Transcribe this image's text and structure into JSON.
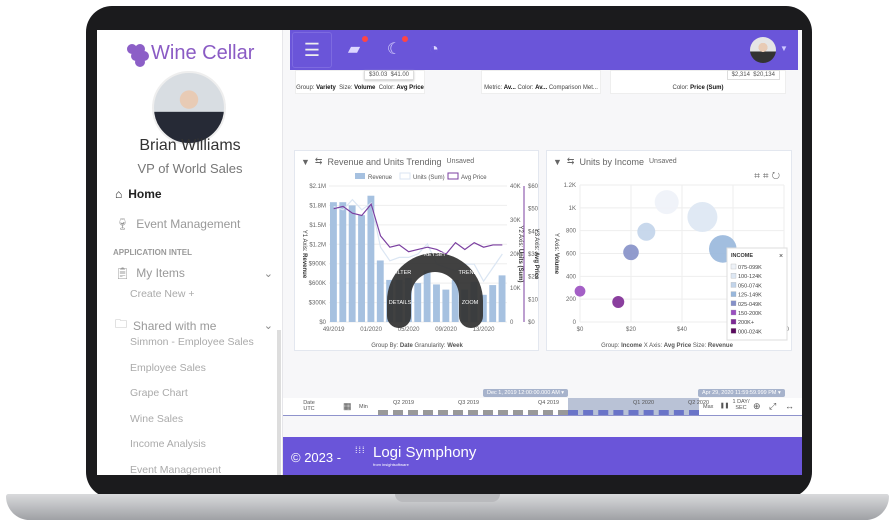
{
  "app": {
    "title": "Wine Cellar"
  },
  "user": {
    "name": "Brian Williams",
    "role": "VP of World Sales"
  },
  "sidebar": {
    "home": "Home",
    "event": "Event Management",
    "section": "APPLICATION INTEL",
    "my_items": "My Items",
    "create_new": "Create New",
    "shared": "Shared with me",
    "shared_items": [
      "Simmon - Employee Sales",
      "Employee Sales",
      "Grape Chart",
      "Wine Sales",
      "Income Analysis",
      "Event Management"
    ]
  },
  "header": {
    "icons": [
      "menu-icon",
      "chat-icon",
      "moon-icon",
      "dashboard-eye-icon"
    ],
    "accent": "#6a55d9"
  },
  "top_cards": [
    {
      "footer": [
        [
          "Group:",
          "Variety"
        ],
        [
          "Size:",
          "Volume"
        ],
        [
          "Color:",
          "Avg Price"
        ]
      ],
      "values": [
        "$30.03",
        "$41.00"
      ]
    },
    {
      "footer": [
        [
          "Metric:",
          "Av..."
        ],
        [
          "Color:",
          "Av..."
        ],
        [
          "Comparison Met...",
          ""
        ]
      ]
    },
    {
      "footer": [
        [
          "Color:",
          "Price (Sum)"
        ]
      ],
      "values": [
        "$2,314",
        "$20,134"
      ]
    }
  ],
  "trend": {
    "title": "Revenue and Units Trending",
    "status": "Unsaved",
    "footer": [
      [
        "Group By:",
        "Date"
      ],
      [
        "Granularity:",
        "Week"
      ]
    ],
    "radial_menu": [
      "KEYSET",
      "FILTER",
      "TREND",
      "DETAILS",
      "ZOOM"
    ],
    "chart_data": {
      "type": "bar",
      "x_ticks": [
        "49/2019",
        "01/2020",
        "05/2020",
        "09/2020",
        "13/2020"
      ],
      "series": [
        {
          "name": "Revenue",
          "axis": "Y1 Axis: Revenue",
          "color": "#a6c1e0",
          "values": [
            1850000,
            1850000,
            1800000,
            1650000,
            1950000,
            950000,
            650000,
            650000,
            680000,
            600000,
            800000,
            580000,
            500000,
            650000,
            500000,
            620000,
            420000,
            570000,
            720000
          ]
        },
        {
          "name": "Units (Sum)",
          "axis": "Y2 Axis: Units (Sum)",
          "color": "#dbe6f3",
          "values": [
            34000,
            33000,
            36000,
            33000,
            35000,
            22000,
            18000,
            19000,
            19000,
            20000,
            23000,
            17000,
            16000,
            15000,
            17000,
            17000,
            12000,
            16000,
            20000
          ]
        },
        {
          "name": "Avg Price",
          "axis": "Y3 Axis: Avg Price",
          "color": "#7b3fa0",
          "values": [
            50,
            51,
            48,
            47,
            52,
            38,
            33,
            34,
            31,
            32,
            33,
            32,
            30,
            35,
            32,
            35,
            33,
            34,
            34
          ]
        }
      ],
      "y1": {
        "label": "Y1 Axis:",
        "name": "Revenue",
        "ticks": [
          "$0",
          "$300K",
          "$600K",
          "$900K",
          "$1.2M",
          "$1.5M",
          "$1.8M",
          "$2.1M"
        ],
        "range": [
          0,
          2100000
        ]
      },
      "y2": {
        "label": "Y2 Axis:",
        "name": "Units (Sum)",
        "ticks": [
          "0",
          "10K",
          "20K",
          "30K",
          "40K"
        ],
        "range": [
          0,
          40000
        ]
      },
      "y3": {
        "label": "Y3 Axis:",
        "name": "Avg Price",
        "ticks": [
          "$0",
          "$10",
          "$20",
          "$30",
          "$40",
          "$50",
          "$60"
        ],
        "range": [
          0,
          60
        ]
      }
    }
  },
  "income": {
    "title": "Units by Income",
    "status": "Unsaved",
    "footer": [
      [
        "Group:",
        "Income"
      ],
      [
        "X Axis:",
        "Avg Price"
      ],
      [
        "Size:",
        "Revenue"
      ]
    ],
    "legend_title": "INCOME",
    "chart_data": {
      "type": "scatter",
      "xlabel": "",
      "ylabel_prefix": "Y Axis:",
      "ylabel": "Volume",
      "x_ticks": [
        "$0",
        "$20",
        "$40",
        "$60",
        "$80"
      ],
      "xlim": [
        0,
        80
      ],
      "y_ticks": [
        "0",
        "200",
        "400",
        "600",
        "800",
        "1K",
        "1.2K"
      ],
      "ylim": [
        0,
        1200
      ],
      "points": [
        {
          "group": "075-099K",
          "x": 34,
          "y": 1050,
          "size": 3,
          "color": "#eef2f8"
        },
        {
          "group": "100-124K",
          "x": 48,
          "y": 920,
          "size": 4,
          "color": "#dde7f3"
        },
        {
          "group": "050-074K",
          "x": 26,
          "y": 790,
          "size": 2,
          "color": "#c2d4ea"
        },
        {
          "group": "125-149K",
          "x": 56,
          "y": 640,
          "size": 3.6,
          "color": "#98b7dc"
        },
        {
          "group": "025-049K",
          "x": 20,
          "y": 610,
          "size": 1.6,
          "color": "#8590c8"
        },
        {
          "group": "150-200K",
          "x": 0,
          "y": 270,
          "size": 0.8,
          "color": "#9a4fc0"
        },
        {
          "group": "200K+",
          "x": 15,
          "y": 175,
          "size": 1,
          "color": "#7d2a94"
        },
        {
          "group": "000-024K",
          "color": "#5a0a5e"
        }
      ]
    }
  },
  "timeline": {
    "label": "Date",
    "tz": "UTC",
    "min": "Min",
    "max": "Max",
    "start": "Dec 1, 2019 12:00:00.000 AM",
    "end": "Apr 29, 2020 11:59:59.999 PM",
    "quarters": [
      "Q2 2019",
      "Q3 2019",
      "Q4 2019",
      "Q1 2020",
      "Q2 2020"
    ],
    "speed": "1 DAY/ SEC"
  },
  "footer": {
    "copyright": "© 2023 -",
    "brand": "Logi Symphony",
    "brand_sub": "from insightsoftware"
  }
}
